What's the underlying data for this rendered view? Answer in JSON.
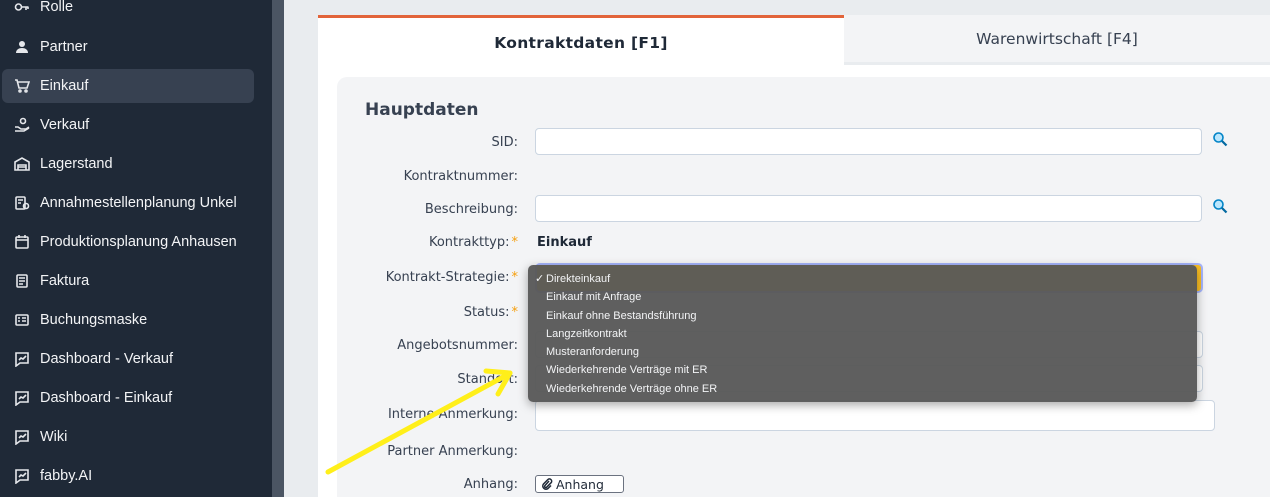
{
  "sidebar": {
    "items": [
      {
        "label": "Rolle",
        "icon": "key-icon",
        "active": false
      },
      {
        "label": "Partner",
        "icon": "user-icon",
        "active": false
      },
      {
        "label": "Einkauf",
        "icon": "cart-icon",
        "active": true
      },
      {
        "label": "Verkauf",
        "icon": "hand-coin-icon",
        "active": false
      },
      {
        "label": "Lagerstand",
        "icon": "warehouse-icon",
        "active": false
      },
      {
        "label": "Annahmestellenplanung Unkel",
        "icon": "clipboard-icon",
        "active": false
      },
      {
        "label": "Produktionsplanung Anhausen",
        "icon": "calendar-icon",
        "active": false
      },
      {
        "label": "Faktura",
        "icon": "invoice-icon",
        "active": false
      },
      {
        "label": "Buchungsmaske",
        "icon": "form-icon",
        "active": false
      },
      {
        "label": "Dashboard - Verkauf",
        "icon": "chart-icon",
        "active": false
      },
      {
        "label": "Dashboard - Einkauf",
        "icon": "chart-icon",
        "active": false
      },
      {
        "label": "Wiki",
        "icon": "chart-icon",
        "active": false
      },
      {
        "label": "fabby.AI",
        "icon": "chart-icon",
        "active": false
      }
    ]
  },
  "tabs": {
    "tab1": "Kontraktdaten [F1]",
    "tab2": "Warenwirtschaft [F4]"
  },
  "form": {
    "section_title": "Hauptdaten",
    "labels": {
      "sid": "SID:",
      "kontraktnummer": "Kontraktnummer:",
      "beschreibung": "Beschreibung:",
      "kontrakttyp": "Kontrakttyp:",
      "strategie": "Kontrakt-Strategie:",
      "status": "Status:",
      "angebotsnummer": "Angebotsnummer:",
      "standort": "Standort:",
      "interne_anmerkung": "Interne Anmerkung:",
      "partner_anmerkung": "Partner Anmerkung:",
      "anhang": "Anhang:"
    },
    "required_marker": "*",
    "kontrakttyp_value": "Einkauf",
    "attach_button": "Anhang"
  },
  "dropdown": {
    "check": "✓",
    "options": [
      "Direkteinkauf",
      "Einkauf mit Anfrage",
      "Einkauf ohne Bestandsführung",
      "Langzeitkontrakt",
      "Musteranforderung",
      "Wiederkehrende Verträge mit ER",
      "Wiederkehrende Verträge ohne ER"
    ],
    "selected": "Direkteinkauf"
  },
  "colors": {
    "accent": "#e2643a",
    "sidebar": "#1f2937",
    "annotation_arrow": "#ffef1a"
  }
}
